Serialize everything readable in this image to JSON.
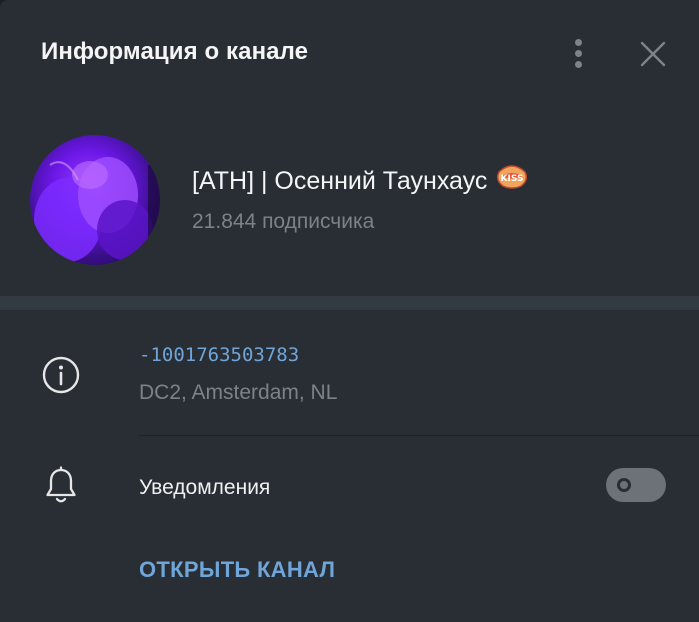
{
  "dialog": {
    "title": "Информация о канале"
  },
  "channel": {
    "name": "[ATH] | Осенний Таунхаус",
    "subscribers": "21.844 подписчика",
    "badge_text": "KISS"
  },
  "info": {
    "id": "-1001763503783",
    "datacenter": "DC2, Amsterdam, NL"
  },
  "notifications": {
    "label": "Уведомления",
    "enabled": false
  },
  "actions": {
    "open_channel": "ОТКРЫТЬ КАНАЛ"
  },
  "icons": {
    "menu": "more-vertical-icon",
    "close": "close-icon",
    "info": "info-icon",
    "bell": "bell-icon"
  },
  "colors": {
    "background": "#282e33",
    "accent": "#6fa5d9",
    "secondary_text": "#7c8288",
    "separator": "#323a42"
  }
}
